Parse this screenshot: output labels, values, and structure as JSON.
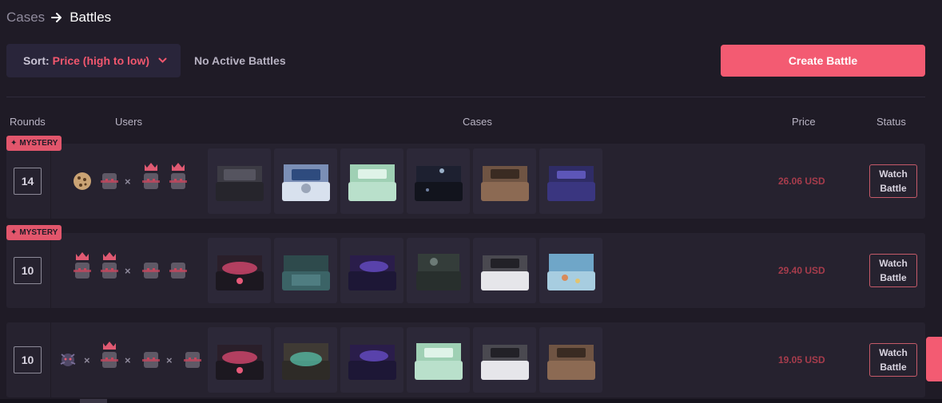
{
  "breadcrumb": {
    "parent": "Cases",
    "current": "Battles",
    "arrow_icon": "arrow-right-icon"
  },
  "toolbar": {
    "sort_label": "Sort:",
    "sort_value": "Price (high to low)",
    "no_active": "No Active Battles",
    "create_label": "Create Battle"
  },
  "columns": {
    "rounds": "Rounds",
    "users": "Users",
    "cases": "Cases",
    "price": "Price",
    "status": "Status"
  },
  "colors": {
    "accent": "#f35b72",
    "background": "#1f1b26",
    "row": "#26222f",
    "tile": "#2c2838"
  },
  "battles": [
    {
      "mystery": true,
      "mystery_label": "MYSTERY",
      "rounds": "14",
      "users": [
        "cookie-avatar",
        "empty-slot",
        "vs",
        "crown-slot",
        "crown-slot"
      ],
      "cases": [
        "black-chest",
        "blue-white-chest",
        "mint-chest",
        "dark-crystal-chest",
        "bronze-chest",
        "purple-chest"
      ],
      "price": "26.06 USD",
      "status": [
        "Watch",
        "Battle"
      ]
    },
    {
      "mystery": true,
      "mystery_label": "MYSTERY",
      "rounds": "10",
      "users": [
        "crown-slot",
        "crown-slot",
        "vs",
        "empty-slot",
        "empty-slot"
      ],
      "cases": [
        "pink-glow-chest",
        "teal-mosaic-chest",
        "galaxy-chest",
        "smoke-chest",
        "white-chest",
        "ocean-chest"
      ],
      "price": "29.40 USD",
      "status": [
        "Watch",
        "Battle"
      ]
    },
    {
      "mystery": false,
      "mystery_label": "",
      "rounds": "10",
      "users": [
        "bug-avatar",
        "vs",
        "crown-slot",
        "vs",
        "empty-slot",
        "vs",
        "empty-slot"
      ],
      "cases": [
        "pink-glow-chest",
        "jade-chest",
        "galaxy-chest",
        "mint-chest",
        "white-chest",
        "bronze-chest"
      ],
      "price": "19.05 USD",
      "status": [
        "Watch",
        "Battle"
      ]
    }
  ]
}
